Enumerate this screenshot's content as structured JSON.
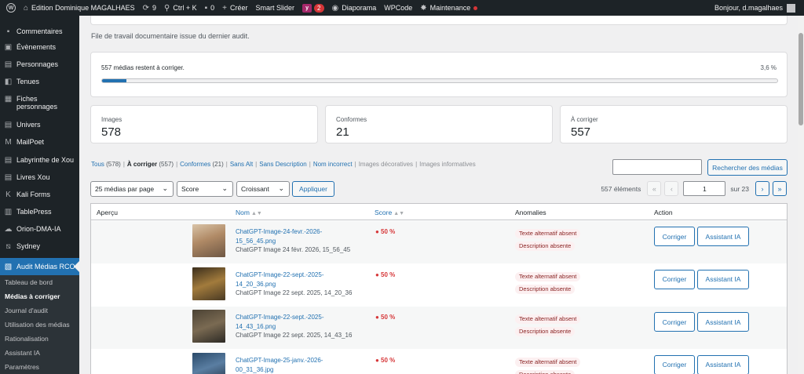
{
  "adminbar": {
    "site_name": "Edition Dominique MAGALHAES",
    "updates_count": "9",
    "search_shortcut": "Ctrl + K",
    "comments_count": "0",
    "new_label": "Créer",
    "smart_slider": "Smart Slider",
    "yoast_count": "2",
    "diaporama": "Diaporama",
    "wpcode": "WPCode",
    "maintenance": "Maintenance",
    "greeting": "Bonjour, d.magalhaes"
  },
  "sidebar": {
    "items": [
      {
        "label": "Commentaires",
        "icon": "comment-icon"
      },
      {
        "label": "Évènements",
        "icon": "calendar-icon"
      },
      {
        "label": "Personnages",
        "icon": "book-icon"
      },
      {
        "label": "Tenues",
        "icon": "tag-icon"
      },
      {
        "label": "Fiches personnages",
        "icon": "sheet-icon"
      },
      {
        "label": "Univers",
        "icon": "book-icon"
      },
      {
        "label": "MailPoet",
        "icon": "mailpoet-icon"
      },
      {
        "label": "Labyrinthe de Xou",
        "icon": "book-icon"
      },
      {
        "label": "Livres Xou",
        "icon": "book-icon"
      },
      {
        "label": "Kali Forms",
        "icon": "kali-icon"
      },
      {
        "label": "TablePress",
        "icon": "table-icon"
      },
      {
        "label": "Orion-DMA-IA",
        "icon": "cloud-icon"
      },
      {
        "label": "Sydney",
        "icon": "stripes-icon"
      },
      {
        "label": "Audit Médias RCO",
        "icon": "image-icon"
      }
    ],
    "submenu": [
      "Tableau de bord",
      "Médias à corriger",
      "Journal d'audit",
      "Utilisation des médias",
      "Rationalisation",
      "Assistant IA",
      "Paramètres"
    ]
  },
  "intro": "File de travail documentaire issue du dernier audit.",
  "progress": {
    "label": "557 médias restent à corriger.",
    "percent_label": "3,6 %",
    "fraction": 0.036
  },
  "stats": [
    {
      "label": "Images",
      "value": "578"
    },
    {
      "label": "Conformes",
      "value": "21"
    },
    {
      "label": "À corriger",
      "value": "557"
    }
  ],
  "filters": {
    "all": "Tous",
    "all_count": "(578)",
    "to_fix": "À corriger",
    "to_fix_count": "(557)",
    "compliant": "Conformes",
    "compliant_count": "(21)",
    "no_alt": "Sans Alt",
    "no_desc": "Sans Description",
    "bad_name": "Nom incorrect",
    "decorative": "Images décoratives",
    "informative": "Images informatives"
  },
  "search": {
    "button": "Rechercher des médias",
    "value": ""
  },
  "toolbar": {
    "per_page": "25 médias par page",
    "sort_by": "Score",
    "order": "Croissant",
    "apply": "Appliquer"
  },
  "pagination": {
    "items": "557 éléments",
    "first": "«",
    "prev": "‹",
    "next": "›",
    "last": "»",
    "page": "1",
    "of": "sur 23"
  },
  "table": {
    "columns": [
      "Aperçu",
      "Nom",
      "Score",
      "Anomalies",
      "Action"
    ],
    "rows": [
      {
        "name": "ChatGPT-Image-24-fevr.-2026-15_56_45.png",
        "title": "ChatGPT Image 24 févr. 2026, 15_56_45",
        "score": "● 50 %",
        "anomalies": [
          "Texte alternatif absent",
          "Description absente"
        ]
      },
      {
        "name": "ChatGPT-Image-22-sept.-2025-14_20_36.png",
        "title": "ChatGPT Image 22 sept. 2025, 14_20_36",
        "score": "● 50 %",
        "anomalies": [
          "Texte alternatif absent",
          "Description absente"
        ]
      },
      {
        "name": "ChatGPT-Image-22-sept.-2025-14_43_16.png",
        "title": "ChatGPT Image 22 sept. 2025, 14_43_16",
        "score": "● 50 %",
        "anomalies": [
          "Texte alternatif absent",
          "Description absente"
        ]
      },
      {
        "name": "ChatGPT-Image-25-janv.-2026-00_31_36.jpg",
        "title": "",
        "score": "● 50 %",
        "anomalies": [
          "Texte alternatif absent",
          "Description absente"
        ]
      }
    ],
    "fix_label": "Corriger",
    "ai_label": "Assistant IA"
  },
  "colors": {
    "accent": "#2271b1",
    "error": "#d63638",
    "admin_bg": "#1d2327"
  }
}
